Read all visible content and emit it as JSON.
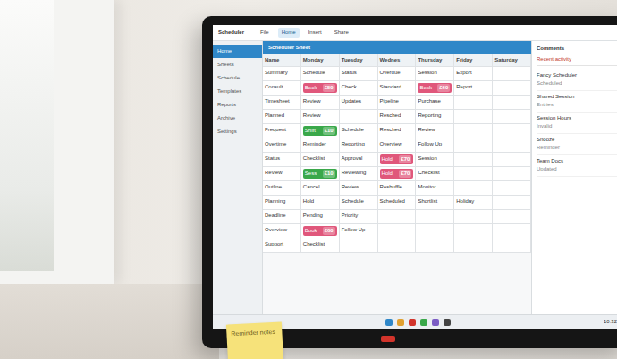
{
  "app": {
    "title": "Scheduler",
    "toolbar": [
      {
        "label": "File",
        "selected": false
      },
      {
        "label": "Home",
        "selected": true
      },
      {
        "label": "Insert",
        "selected": false
      },
      {
        "label": "Share",
        "selected": false
      }
    ]
  },
  "sidebar": {
    "items": [
      {
        "label": "Home",
        "selected": true
      },
      {
        "label": "Sheets",
        "selected": false
      },
      {
        "label": "Schedule",
        "selected": false
      },
      {
        "label": "Templates",
        "selected": false
      },
      {
        "label": "Reports",
        "selected": false
      },
      {
        "label": "Archive",
        "selected": false
      },
      {
        "label": "Settings",
        "selected": false
      }
    ]
  },
  "sheet": {
    "title": "Scheduler Sheet",
    "columns": [
      "Name",
      "Monday",
      "Tuesday",
      "Wednes",
      "Thursday",
      "Friday",
      "Saturday"
    ],
    "rows": [
      [
        {
          "kind": "text",
          "text": "Summary"
        },
        {
          "kind": "text",
          "text": "Schedule"
        },
        {
          "kind": "text",
          "text": "Status"
        },
        {
          "kind": "text",
          "text": "Overdue"
        },
        {
          "kind": "text",
          "text": "Session"
        },
        {
          "kind": "text",
          "text": "Export"
        },
        {
          "kind": "text",
          "text": ""
        }
      ],
      [
        {
          "kind": "text",
          "text": "Consult"
        },
        {
          "kind": "tag",
          "text": "Book",
          "price": "£50",
          "color": "#e0577b"
        },
        {
          "kind": "text",
          "text": "Check"
        },
        {
          "kind": "text",
          "text": "Standard"
        },
        {
          "kind": "tag",
          "text": "Book",
          "price": "£60",
          "color": "#e0577b"
        },
        {
          "kind": "text",
          "text": "Report"
        },
        {
          "kind": "text",
          "text": ""
        }
      ],
      [
        {
          "kind": "text",
          "text": "Timesheet"
        },
        {
          "kind": "text",
          "text": "Review"
        },
        {
          "kind": "text",
          "text": "Updates"
        },
        {
          "kind": "text",
          "text": "Pipeline"
        },
        {
          "kind": "text",
          "text": "Purchase"
        },
        {
          "kind": "text",
          "text": ""
        },
        {
          "kind": "text",
          "text": ""
        }
      ],
      [
        {
          "kind": "text",
          "text": "Planned"
        },
        {
          "kind": "text",
          "text": "Review"
        },
        {
          "kind": "text",
          "text": ""
        },
        {
          "kind": "text",
          "text": "Resched"
        },
        {
          "kind": "text",
          "text": "Reporting"
        },
        {
          "kind": "text",
          "text": ""
        },
        {
          "kind": "text",
          "text": ""
        }
      ],
      [
        {
          "kind": "text",
          "text": "Frequent"
        },
        {
          "kind": "tag",
          "text": "Shift",
          "price": "£10",
          "color": "#3aa84a"
        },
        {
          "kind": "text",
          "text": "Schedule"
        },
        {
          "kind": "text",
          "text": "Resched"
        },
        {
          "kind": "text",
          "text": "Review"
        },
        {
          "kind": "text",
          "text": ""
        },
        {
          "kind": "text",
          "text": ""
        }
      ],
      [
        {
          "kind": "text",
          "text": "Overtime"
        },
        {
          "kind": "text",
          "text": "Reminder"
        },
        {
          "kind": "text",
          "text": "Reporting"
        },
        {
          "kind": "text",
          "text": "Overview"
        },
        {
          "kind": "text",
          "text": "Follow Up"
        },
        {
          "kind": "text",
          "text": ""
        },
        {
          "kind": "text",
          "text": ""
        }
      ],
      [
        {
          "kind": "text",
          "text": "Status"
        },
        {
          "kind": "text",
          "text": "Checklist"
        },
        {
          "kind": "text",
          "text": "Approval"
        },
        {
          "kind": "tag",
          "text": "Hold",
          "price": "£70",
          "color": "#e0577b"
        },
        {
          "kind": "text",
          "text": "Session"
        },
        {
          "kind": "text",
          "text": ""
        },
        {
          "kind": "text",
          "text": ""
        }
      ],
      [
        {
          "kind": "text",
          "text": "Review"
        },
        {
          "kind": "tag",
          "text": "Sess",
          "price": "£10",
          "color": "#3aa84a"
        },
        {
          "kind": "text",
          "text": "Reviewing"
        },
        {
          "kind": "tag",
          "text": "Hold",
          "price": "£70",
          "color": "#e0577b"
        },
        {
          "kind": "text",
          "text": "Checklist"
        },
        {
          "kind": "text",
          "text": ""
        },
        {
          "kind": "text",
          "text": ""
        }
      ],
      [
        {
          "kind": "text",
          "text": "Outline"
        },
        {
          "kind": "text",
          "text": "Cancel"
        },
        {
          "kind": "text",
          "text": "Review"
        },
        {
          "kind": "text",
          "text": "Reshuffle"
        },
        {
          "kind": "text",
          "text": "Monitor"
        },
        {
          "kind": "text",
          "text": ""
        },
        {
          "kind": "text",
          "text": ""
        }
      ],
      [
        {
          "kind": "text",
          "text": "Planning"
        },
        {
          "kind": "text",
          "text": "Hold"
        },
        {
          "kind": "text",
          "text": "Schedule"
        },
        {
          "kind": "text",
          "text": "Scheduled"
        },
        {
          "kind": "text",
          "text": "Shortlist"
        },
        {
          "kind": "text",
          "text": "Holiday"
        },
        {
          "kind": "text",
          "text": ""
        }
      ],
      [
        {
          "kind": "text",
          "text": "Deadline"
        },
        {
          "kind": "text",
          "text": "Pending"
        },
        {
          "kind": "text",
          "text": "Priority"
        },
        {
          "kind": "text",
          "text": ""
        },
        {
          "kind": "text",
          "text": ""
        },
        {
          "kind": "text",
          "text": ""
        },
        {
          "kind": "text",
          "text": ""
        }
      ],
      [
        {
          "kind": "text",
          "text": "Overview"
        },
        {
          "kind": "tag",
          "text": "Book",
          "price": "£60",
          "color": "#e0577b"
        },
        {
          "kind": "text",
          "text": "Follow Up"
        },
        {
          "kind": "text",
          "text": ""
        },
        {
          "kind": "text",
          "text": ""
        },
        {
          "kind": "text",
          "text": ""
        },
        {
          "kind": "text",
          "text": ""
        }
      ],
      [
        {
          "kind": "text",
          "text": "Support"
        },
        {
          "kind": "text",
          "text": "Checklist"
        },
        {
          "kind": "text",
          "text": ""
        },
        {
          "kind": "text",
          "text": ""
        },
        {
          "kind": "text",
          "text": ""
        },
        {
          "kind": "text",
          "text": ""
        },
        {
          "kind": "text",
          "text": ""
        }
      ]
    ]
  },
  "comments": {
    "title": "Comments",
    "subtitle": "Recent activity",
    "items": [
      {
        "title": "Fancy Scheduler",
        "meta": "Scheduled"
      },
      {
        "title": "Shared Session",
        "meta": "Entries"
      },
      {
        "title": "Session Hours",
        "meta": "Invalid"
      },
      {
        "title": "Snooze",
        "meta": "Reminder"
      },
      {
        "title": "Team Docs",
        "meta": "Updated"
      }
    ]
  },
  "taskbar": {
    "clock": "10:32",
    "apps": [
      {
        "color": "#2f87c8"
      },
      {
        "color": "#e0a030"
      },
      {
        "color": "#d2342b"
      },
      {
        "color": "#3aa84a"
      },
      {
        "color": "#7b5cc4"
      },
      {
        "color": "#444444"
      }
    ]
  },
  "sticky_note": {
    "text": "Reminder notes"
  }
}
